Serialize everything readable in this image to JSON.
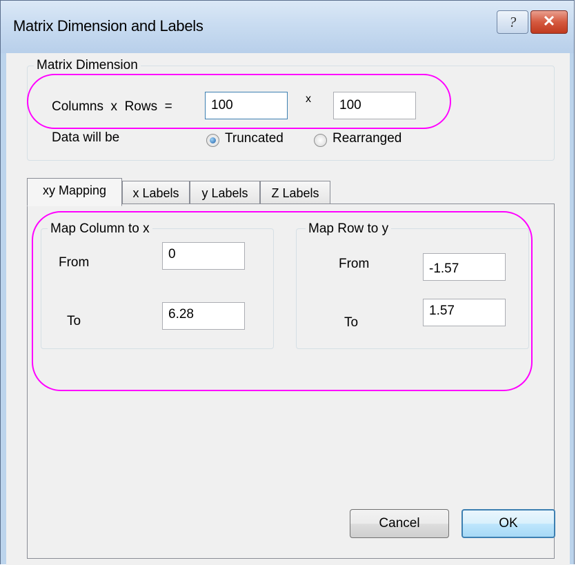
{
  "window": {
    "title": "Matrix Dimension and Labels",
    "help_label": "?",
    "close_label": "✕"
  },
  "matrix_dimension": {
    "caption": "Matrix Dimension",
    "columns_rows_label": "Columns  x  Rows  =",
    "columns_value": "100",
    "times_symbol": "x",
    "rows_value": "100",
    "data_will_be_label": "Data will be",
    "options": [
      {
        "label": "Truncated",
        "selected": true
      },
      {
        "label": "Rearranged",
        "selected": false
      }
    ]
  },
  "tabs": [
    {
      "label": "xy Mapping",
      "active": true
    },
    {
      "label": "x Labels",
      "active": false
    },
    {
      "label": "y Labels",
      "active": false
    },
    {
      "label": "Z Labels",
      "active": false
    }
  ],
  "map_column_to_x": {
    "caption": "Map Column to x",
    "from_label": "From",
    "from_value": "0",
    "to_label": "To",
    "to_value": "6.28"
  },
  "map_row_to_y": {
    "caption": "Map Row to y",
    "from_label": "From",
    "from_value": "-1.57",
    "to_label": "To",
    "to_value": "1.57"
  },
  "buttons": {
    "cancel": "Cancel",
    "ok": "OK"
  },
  "colors": {
    "highlight": "#ff00ff",
    "title_bar": "#c9dcf1",
    "close_button": "#c03a1f"
  }
}
